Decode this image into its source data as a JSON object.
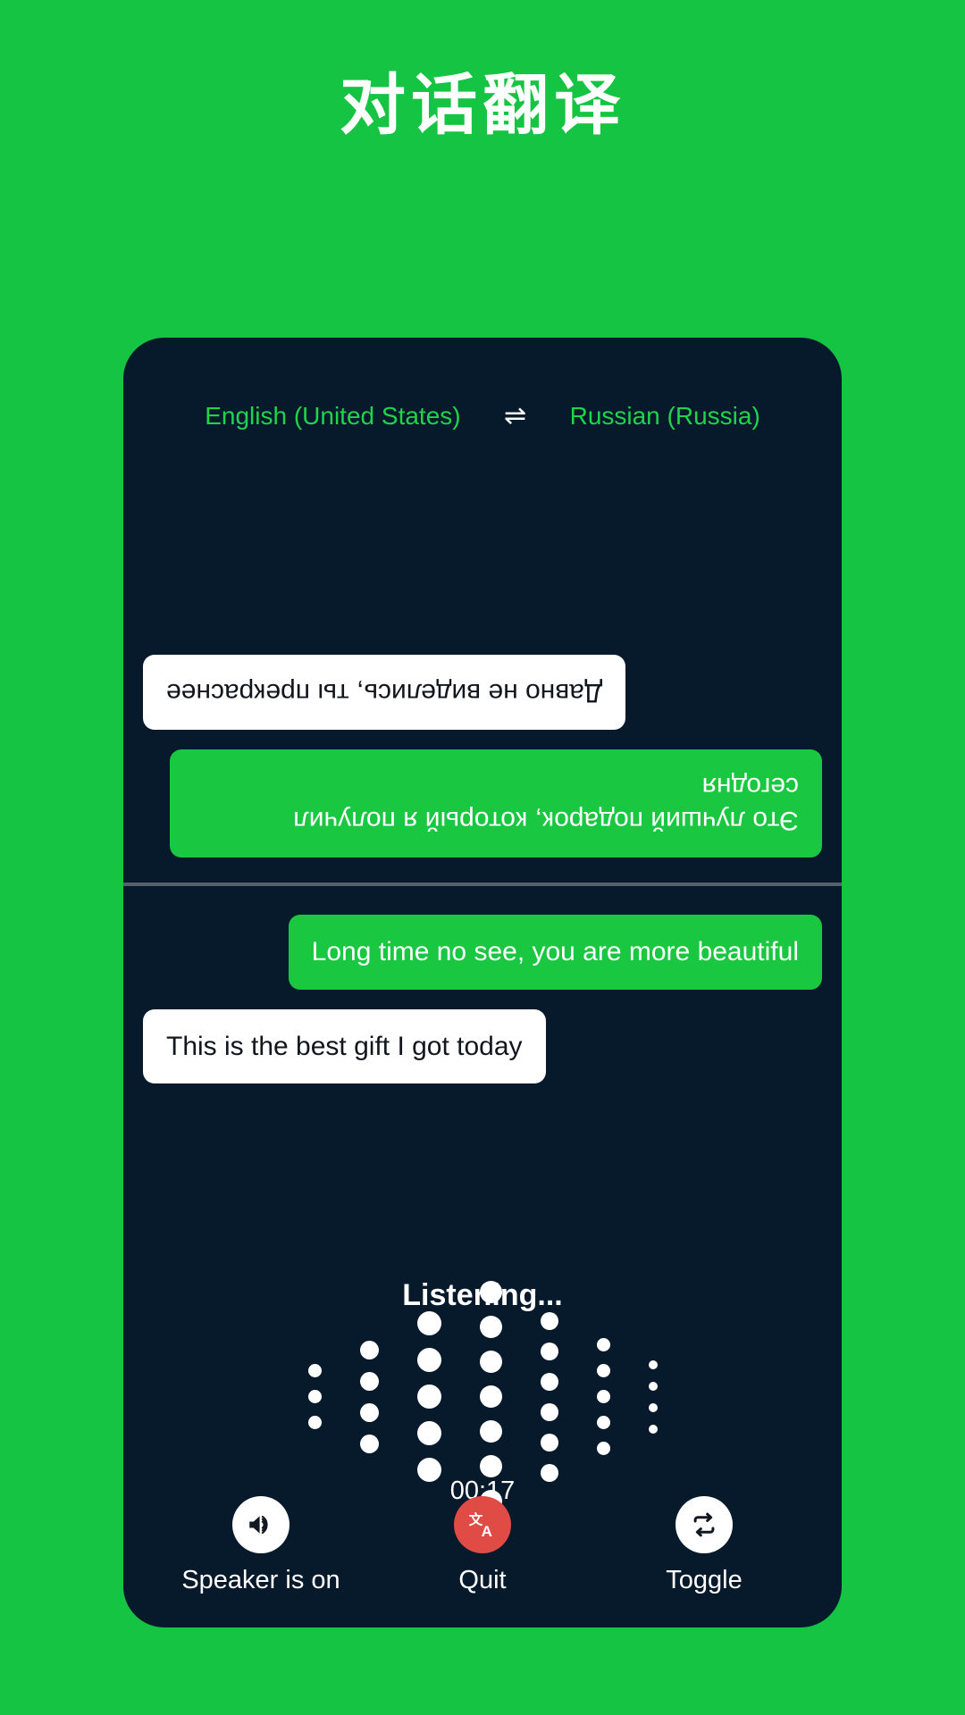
{
  "header": {
    "title": "对话翻译"
  },
  "language_bar": {
    "source": "English (United States)",
    "swap_icon": "swap-horizontal-icon",
    "swap_glyph": "⇌",
    "target": "Russian (Russia)"
  },
  "conversation": {
    "remote_pane": {
      "orientation_degrees": 180,
      "messages": [
        {
          "text": "Это лучший подарок, который я получил сегодня",
          "style": "green",
          "align": "start"
        },
        {
          "text": "Давно не виделись, ты прекраснее",
          "style": "white",
          "align": "end"
        }
      ]
    },
    "local_pane": {
      "orientation_degrees": 0,
      "messages": [
        {
          "text": "Long time no see, you are more beautiful",
          "style": "green",
          "align": "end"
        },
        {
          "text": "This is the best gift I got today",
          "style": "white",
          "align": "start"
        }
      ]
    }
  },
  "status": {
    "listening_label": "Listening...",
    "timer": "00:17"
  },
  "waveform": {
    "columns": [
      {
        "dots": 3,
        "size": 15
      },
      {
        "dots": 4,
        "size": 21
      },
      {
        "dots": 5,
        "size": 27
      },
      {
        "dots": 7,
        "size": 25
      },
      {
        "dots": 6,
        "size": 20
      },
      {
        "dots": 5,
        "size": 15
      },
      {
        "dots": 4,
        "size": 10
      }
    ],
    "gap": 14
  },
  "actions": [
    {
      "label": "Speaker is on",
      "icon": "speaker-on-icon",
      "circle_style": "light",
      "name": "speaker-button"
    },
    {
      "label": "Quit",
      "icon": "translate-icon",
      "circle_style": "danger",
      "name": "quit-button"
    },
    {
      "label": "Toggle",
      "icon": "repeat-swap-icon",
      "circle_style": "light",
      "name": "toggle-button"
    }
  ],
  "colors": {
    "background_green": "#16C443",
    "card_navy": "#071A2B",
    "bubble_green": "#19C741",
    "bubble_white": "#FFFFFF",
    "accent_green_text": "#1FD34C",
    "danger_red": "#E14B45",
    "divider_gray": "#57616B"
  }
}
